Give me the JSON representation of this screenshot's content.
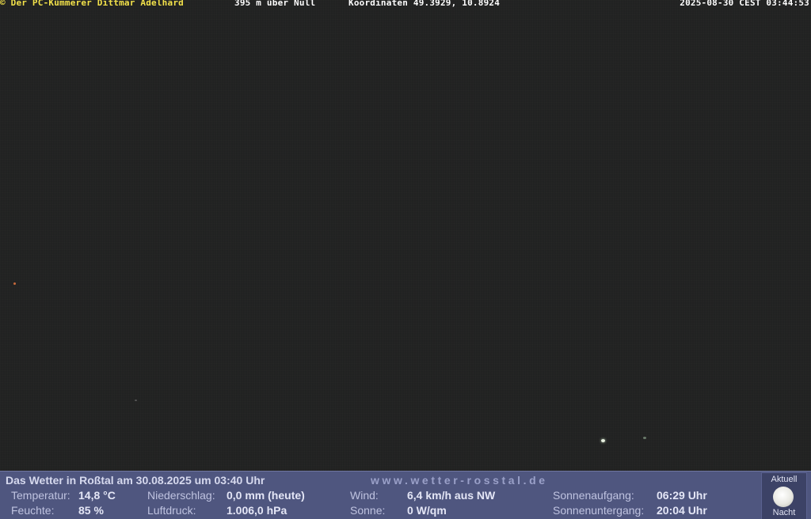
{
  "overlay": {
    "owner": "© Der PC-Kümmerer Dittmar Adelhard",
    "altitude": "395 m über Null",
    "coordinates": "Koordinaten 49.3929, 10.8924",
    "timestamp": "2025-08-30 CEST 03:44:53"
  },
  "weather": {
    "title": "Das Wetter in Roßtal am 30.08.2025 um 03:40 Uhr",
    "url": "www.wetter-rosstal.de",
    "temperature_label": "Temperatur:",
    "temperature_value": "14,8 °C",
    "humidity_label": "Feuchte:",
    "humidity_value": "85 %",
    "precip_label": "Niederschlag:",
    "precip_value": "0,0 mm (heute)",
    "pressure_label": "Luftdruck:",
    "pressure_value": "1.006,0 hPa",
    "wind_label": "Wind:",
    "wind_value": "6,4 km/h aus NW",
    "sun_label": "Sonne:",
    "sun_value": "0 W/qm",
    "sunrise_label": "Sonnenaufgang:",
    "sunrise_value": "06:29 Uhr",
    "sunset_label": "Sonnenuntergang:",
    "sunset_value": "20:04 Uhr"
  },
  "moon": {
    "top_label": "Aktuell",
    "bottom_label": "Nacht",
    "icon": "moon-icon"
  },
  "colors": {
    "overlay_owner": "#f3e24a",
    "overlay_text": "#ffffff",
    "weather_bar": "#4f567f"
  }
}
